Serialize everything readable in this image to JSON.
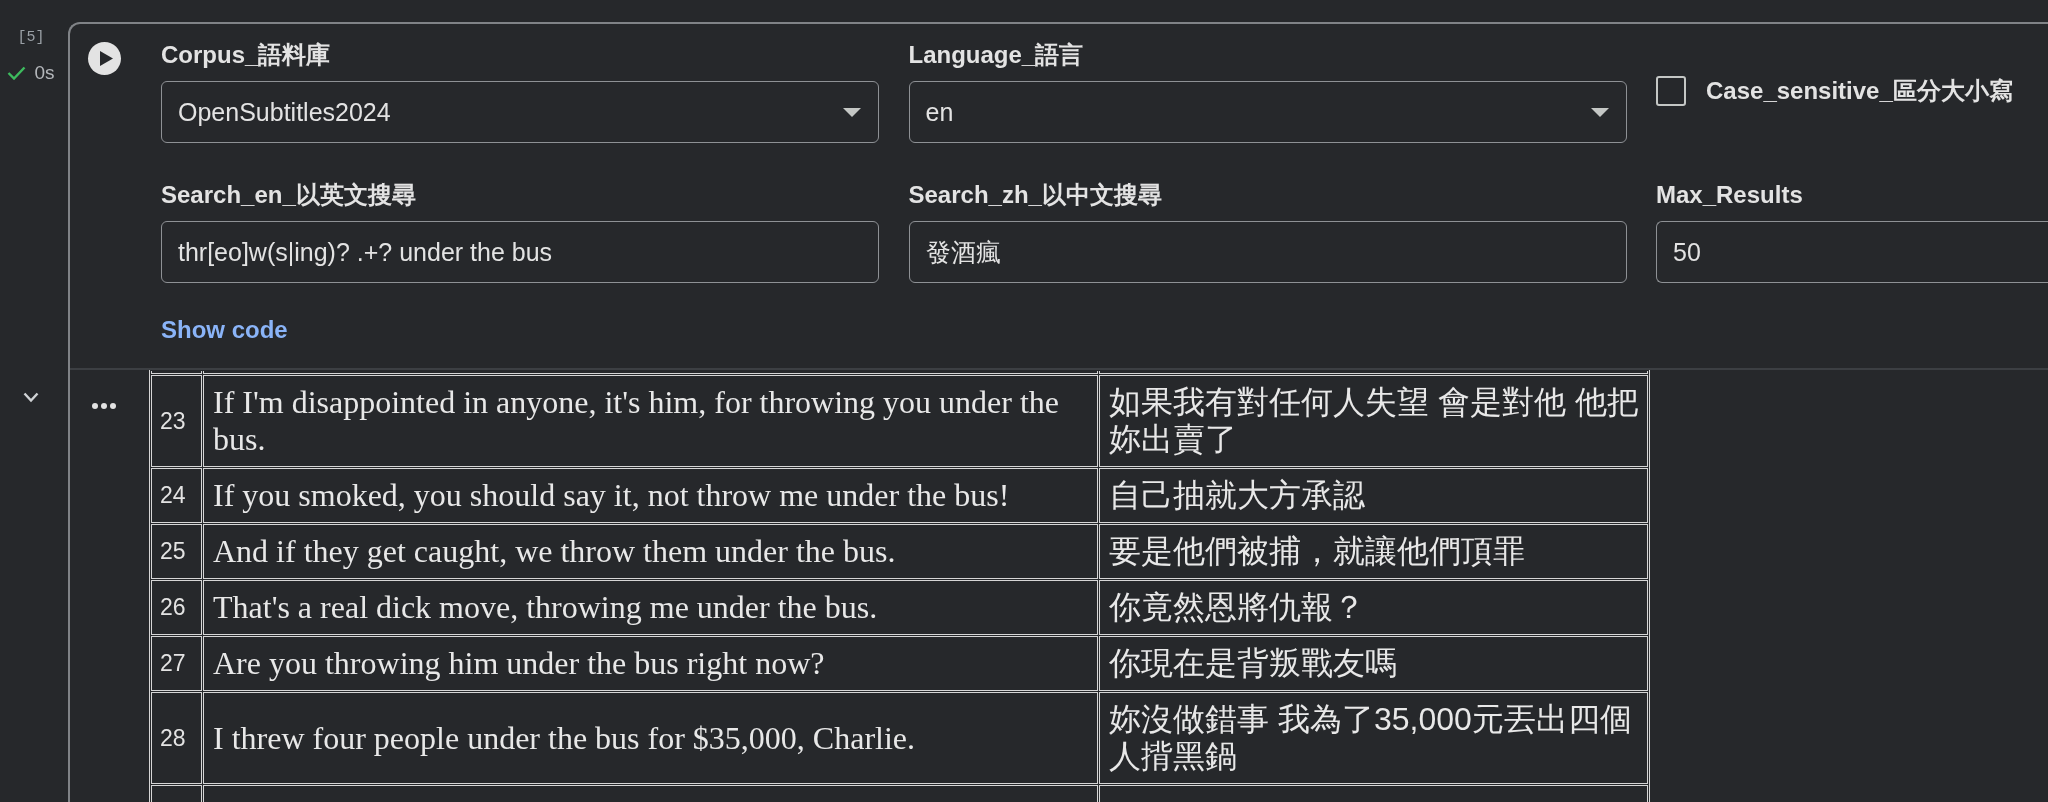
{
  "cell": {
    "execution_count": "[5]",
    "run_status": {
      "kind": "success",
      "duration": "0s"
    }
  },
  "form": {
    "fields": [
      {
        "kind": "dropdown",
        "label": "Corpus_語料庫",
        "value": "OpenSubtitles2024"
      },
      {
        "kind": "dropdown",
        "label": "Language_語言",
        "value": "en"
      },
      {
        "kind": "checkbox",
        "label": "Case_sensitive_區分大小寫",
        "checked": false
      },
      {
        "kind": "text",
        "label": "Search_en_以英文搜尋",
        "value": "thr[eo]w(s|ing)? .+? under the bus"
      },
      {
        "kind": "text",
        "label": "Search_zh_以中文搜尋",
        "value": "發酒瘋"
      },
      {
        "kind": "text",
        "label": "Max_Results",
        "value": "50"
      }
    ],
    "show_code": "Show code"
  },
  "output": {
    "table": {
      "rows": [
        {
          "index": "23",
          "english": "If I'm disappointed in anyone, it's him, for throwing you under the bus.",
          "chinese": "如果我有對任何人失望 會是對他 他把妳出賣了"
        },
        {
          "index": "24",
          "english": "If you smoked, you should say it, not throw me under the bus!",
          "chinese": "自己抽就大方承認"
        },
        {
          "index": "25",
          "english": "And if they get caught, we throw them under the bus.",
          "chinese": "要是他們被捕，就讓他們頂罪"
        },
        {
          "index": "26",
          "english": "That's a real dick move, throwing me under the bus.",
          "chinese": "你竟然恩將仇報？"
        },
        {
          "index": "27",
          "english": "Are you throwing him under the bus right now?",
          "chinese": "你現在是背叛戰友嗎"
        },
        {
          "index": "28",
          "english": "I threw four people under the bus for $35,000, Charlie.",
          "chinese": "妳沒做錯事 我為了35,000元丟出四個人揹黑鍋"
        }
      ]
    }
  }
}
